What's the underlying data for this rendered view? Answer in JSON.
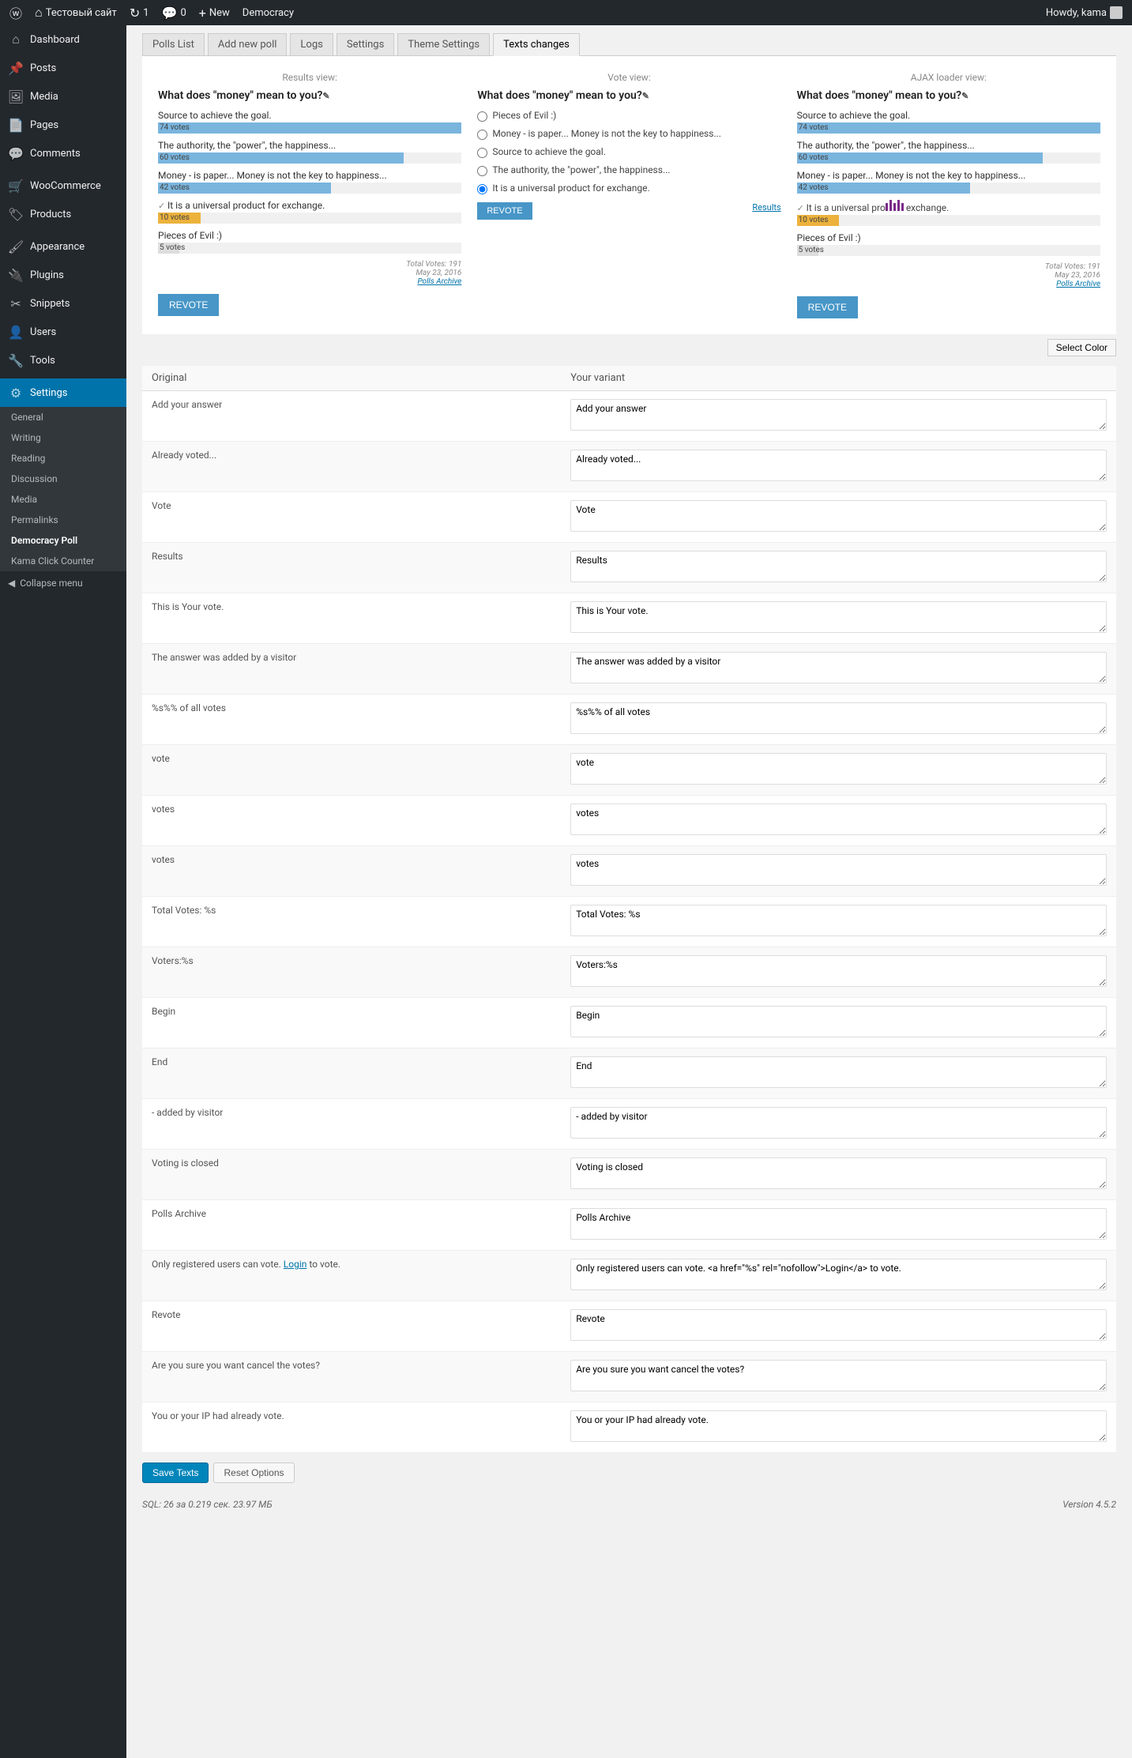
{
  "adminbar": {
    "site_name": "Тестовый сайт",
    "updates": "1",
    "comments": "0",
    "new": "New",
    "democracy": "Democracy",
    "howdy": "Howdy, kama"
  },
  "sidebar": {
    "items": [
      {
        "label": "Dashboard",
        "icon": "⌂"
      },
      {
        "label": "Posts",
        "icon": "📌"
      },
      {
        "label": "Media",
        "icon": "🖼"
      },
      {
        "label": "Pages",
        "icon": "📄"
      },
      {
        "label": "Comments",
        "icon": "💬"
      },
      {
        "label": "WooCommerce",
        "icon": "🛒"
      },
      {
        "label": "Products",
        "icon": "🏷"
      },
      {
        "label": "Appearance",
        "icon": "🖌"
      },
      {
        "label": "Plugins",
        "icon": "🔌"
      },
      {
        "label": "Snippets",
        "icon": "✂"
      },
      {
        "label": "Users",
        "icon": "👤"
      },
      {
        "label": "Tools",
        "icon": "🔧"
      },
      {
        "label": "Settings",
        "icon": "⚙"
      }
    ],
    "sub": [
      "General",
      "Writing",
      "Reading",
      "Discussion",
      "Media",
      "Permalinks",
      "Democracy Poll",
      "Kama Click Counter"
    ],
    "collapse": "Collapse menu"
  },
  "tabs": [
    "Polls List",
    "Add new poll",
    "Logs",
    "Settings",
    "Theme Settings",
    "Texts changes"
  ],
  "preview": {
    "titles": [
      "Results view:",
      "Vote view:",
      "AJAX loader view:"
    ],
    "poll_title": "What does \"money\" mean to you?",
    "answers": [
      {
        "label": "Source to achieve the goal.",
        "votes": "74 votes",
        "pct": 100,
        "color": "#7ab5de"
      },
      {
        "label": "The authority, the \"power\", the happiness...",
        "votes": "60 votes",
        "pct": 81,
        "color": "#7ab5de"
      },
      {
        "label": "Money - is paper... Money is not the key to happiness...",
        "votes": "42 votes",
        "pct": 57,
        "color": "#7ab5de"
      },
      {
        "label": "It is a universal product for exchange.",
        "votes": "10 votes",
        "pct": 14,
        "color": "#ecb23c",
        "checked": true
      },
      {
        "label": "Pieces of Evil :)",
        "votes": "5 votes",
        "pct": 7,
        "color": "#ddd"
      }
    ],
    "vote_options": [
      "Pieces of Evil :)",
      "Money - is paper... Money is not the key to happiness...",
      "Source to achieve the goal.",
      "The authority, the \"power\", the happiness...",
      "It is a universal product for exchange."
    ],
    "total": "Total Votes: 191",
    "date": "May 23, 2016",
    "archive": "Polls Archive",
    "revote": "REVOTE",
    "results": "Results",
    "select_color": "Select Color"
  },
  "table": {
    "headers": [
      "Original",
      "Your variant"
    ],
    "rows": [
      {
        "orig": "Add your answer",
        "val": "Add your answer"
      },
      {
        "orig": "Already voted...",
        "val": "Already voted..."
      },
      {
        "orig": "Vote",
        "val": "Vote"
      },
      {
        "orig": "Results",
        "val": "Results"
      },
      {
        "orig": "This is Your vote.",
        "val": "This is Your vote."
      },
      {
        "orig": "The answer was added by a visitor",
        "val": "The answer was added by a visitor"
      },
      {
        "orig": "%s%% of all votes",
        "val": "%s%% of all votes"
      },
      {
        "orig": "vote",
        "val": "vote"
      },
      {
        "orig": "votes",
        "val": "votes"
      },
      {
        "orig": "votes",
        "val": "votes"
      },
      {
        "orig": "Total Votes: %s",
        "val": "Total Votes: %s"
      },
      {
        "orig": "Voters:%s",
        "val": "Voters:%s"
      },
      {
        "orig": "Begin",
        "val": "Begin"
      },
      {
        "orig": "End",
        "val": "End"
      },
      {
        "orig": "- added by visitor",
        "val": "- added by visitor"
      },
      {
        "orig": "Voting is closed",
        "val": "Voting is closed"
      },
      {
        "orig": "Polls Archive",
        "val": "Polls Archive"
      },
      {
        "orig_html": "Only registered users can vote. <a href=\"#\">Login</a> to vote.",
        "val": "Only registered users can vote. <a href=\"%s\" rel=\"nofollow\">Login</a> to vote."
      },
      {
        "orig": "Revote",
        "val": "Revote"
      },
      {
        "orig": "Are you sure you want cancel the votes?",
        "val": "Are you sure you want cancel the votes?"
      },
      {
        "orig": "You or your IP had already vote.",
        "val": "You or your IP had already vote."
      }
    ]
  },
  "buttons": {
    "save": "Save Texts",
    "reset": "Reset Options"
  },
  "footer": {
    "sql": "SQL: 26 за 0.219 сек. 23.97 МБ",
    "version": "Version 4.5.2"
  }
}
